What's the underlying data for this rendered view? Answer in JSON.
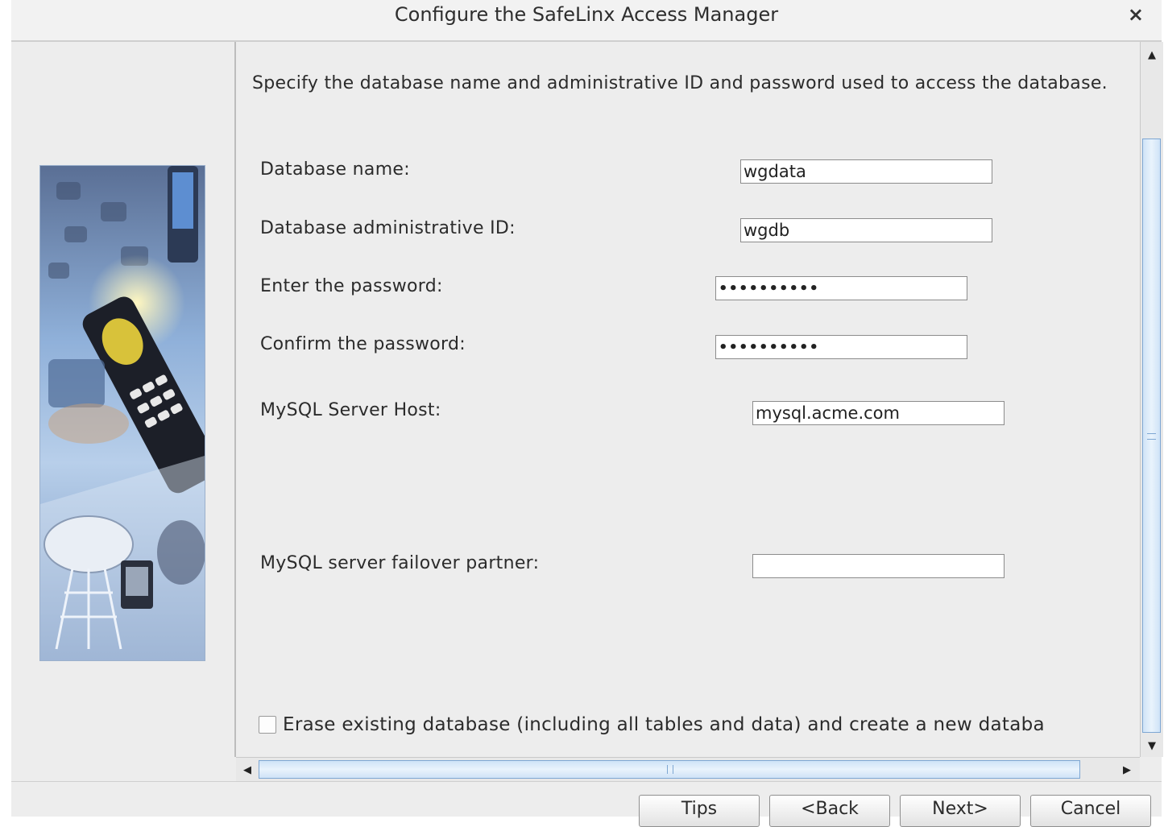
{
  "window": {
    "title": "Configure the SafeLinx Access Manager",
    "close_label": "×"
  },
  "instruction": "Specify the database name and administrative ID and password used to access the database.",
  "fields": {
    "db_name": {
      "label": "Database name:",
      "value": "wgdata"
    },
    "admin_id": {
      "label": "Database administrative ID:",
      "value": "wgdb"
    },
    "password": {
      "label": "Enter the password:",
      "value": "••••••••••"
    },
    "confirm": {
      "label": "Confirm the password:",
      "value": "••••••••••"
    },
    "host": {
      "label": "MySQL Server Host:",
      "value": "mysql.acme.com"
    },
    "failover": {
      "label": "MySQL server failover partner:",
      "value": ""
    }
  },
  "erase": {
    "label": "Erase existing database (including all tables and data) and create a new databa",
    "checked": false
  },
  "buttons": {
    "tips": "Tips",
    "back": "<Back",
    "next": "Next>",
    "cancel": "Cancel"
  },
  "scroll": {
    "up_arrow": "▲",
    "down_arrow": "▼",
    "left_arrow": "◀",
    "right_arrow": "▶"
  },
  "icons": {
    "side_image": "mobile-communications-collage",
    "close": "close-icon"
  },
  "colors": {
    "background": "#ededed",
    "scroll_thumb": "#cfe3f7",
    "scroll_border": "#7ea7d3"
  }
}
